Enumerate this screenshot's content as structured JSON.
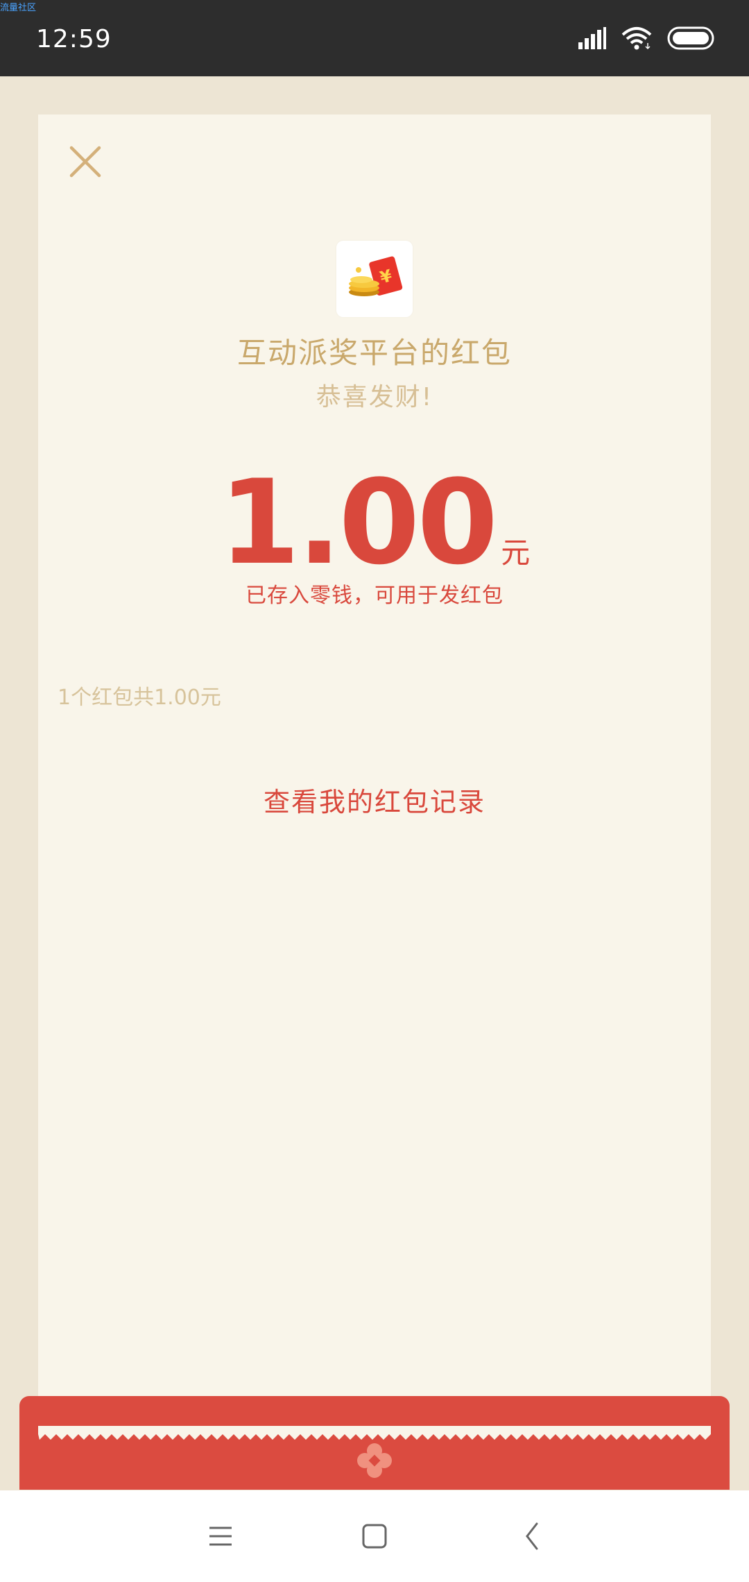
{
  "status_bar": {
    "watermark": "流量社区",
    "time": "12:59"
  },
  "packet": {
    "sender": "互动派奖平台的红包",
    "greeting": "恭喜发财!",
    "amount": "1.00",
    "unit": "元",
    "stored_note": "已存入零钱，可用于发红包",
    "summary": "1个红包共1.00元",
    "record_link": "查看我的红包记录"
  },
  "colors": {
    "accent_red": "#d9483c",
    "gold": "#c9a86b",
    "card_bg": "#f9f5ea"
  },
  "icons": [
    "close-icon",
    "red-envelope-logo-icon",
    "signal-icon",
    "wifi-icon",
    "battery-icon",
    "menu-icon",
    "home-icon",
    "back-icon"
  ]
}
